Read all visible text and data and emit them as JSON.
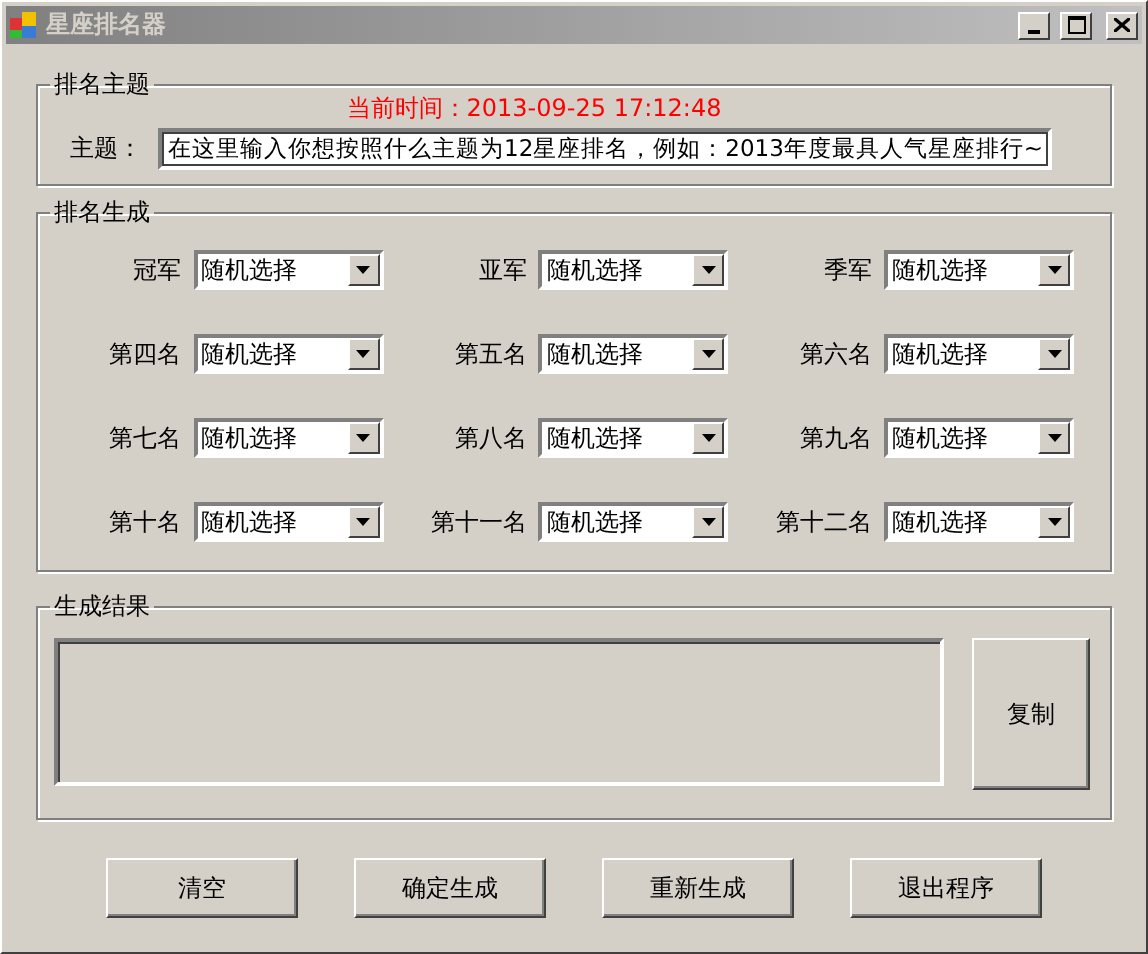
{
  "window": {
    "title": "星座排名器"
  },
  "topic_group": {
    "title": "排名主题",
    "current_time": "当前时间：2013-09-25 17:12:48",
    "label": "主题：",
    "value": "在这里输入你想按照什么主题为12星座排名，例如：2013年度最具人气星座排行~"
  },
  "ranking_group": {
    "title": "排名生成",
    "slots": [
      {
        "label": "冠军",
        "value": "随机选择"
      },
      {
        "label": "亚军",
        "value": "随机选择"
      },
      {
        "label": "季军",
        "value": "随机选择"
      },
      {
        "label": "第四名",
        "value": "随机选择"
      },
      {
        "label": "第五名",
        "value": "随机选择"
      },
      {
        "label": "第六名",
        "value": "随机选择"
      },
      {
        "label": "第七名",
        "value": "随机选择"
      },
      {
        "label": "第八名",
        "value": "随机选择"
      },
      {
        "label": "第九名",
        "value": "随机选择"
      },
      {
        "label": "第十名",
        "value": "随机选择"
      },
      {
        "label": "第十一名",
        "value": "随机选择"
      },
      {
        "label": "第十二名",
        "value": "随机选择"
      }
    ]
  },
  "result_group": {
    "title": "生成结果",
    "copy_button": "复制"
  },
  "buttons": [
    "清空",
    "确定生成",
    "重新生成",
    "退出程序"
  ]
}
